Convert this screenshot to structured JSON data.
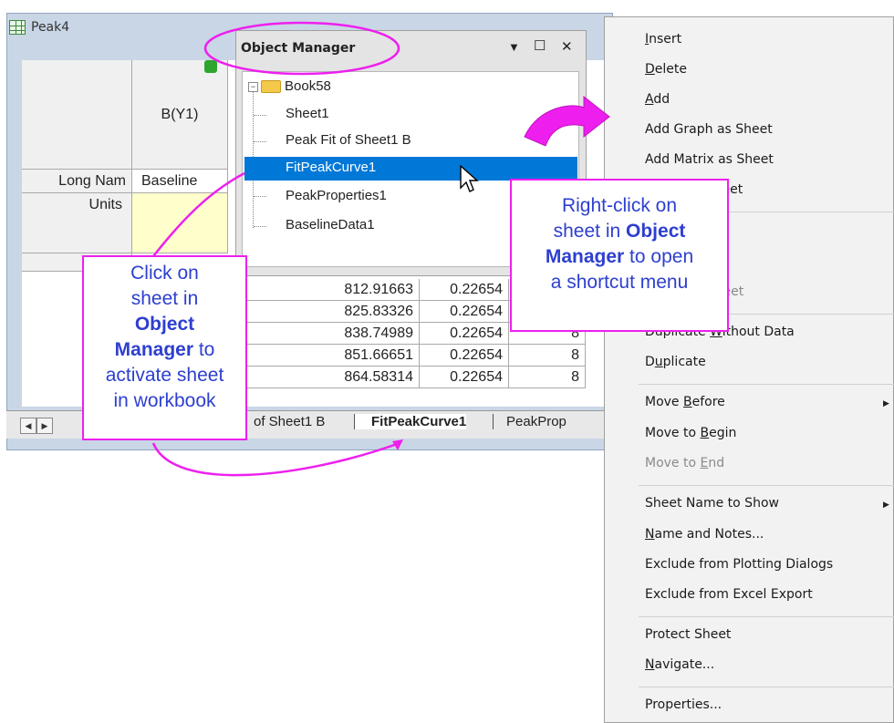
{
  "workbook": {
    "title": "Peak4",
    "col_b_header": "B(Y1)",
    "row_longname": "Long Nam",
    "row_units": "Units",
    "longname_b": "Baseline",
    "rows": [
      {
        "c": "812.91663",
        "d": "0.22654",
        "e": "8"
      },
      {
        "c": "825.83326",
        "d": "0.22654",
        "e": "8"
      },
      {
        "c": "838.74989",
        "d": "0.22654",
        "e": "8"
      },
      {
        "c": "851.66651",
        "d": "0.22654",
        "e": "8"
      },
      {
        "c": "864.58314",
        "d": "0.22654",
        "e": "8"
      }
    ],
    "tabs": {
      "tab1": "of Sheet1 B",
      "tab2": "FitPeakCurve1",
      "tab3": "PeakProp"
    },
    "nav_prev": "◀",
    "nav_next": "▶"
  },
  "object_manager": {
    "title": "Object Manager",
    "dropdown_label": "▼",
    "maximize_label": "☐",
    "close_label": "✕",
    "book": "Book58",
    "items": [
      "Sheet1",
      "Peak Fit of Sheet1 B",
      "FitPeakCurve1",
      "PeakProperties1",
      "BaselineData1"
    ],
    "selected_index": 2
  },
  "context_menu": {
    "insert": "Insert",
    "delete": "Delete",
    "add": "Add",
    "add_graph": "Add Graph as Sheet",
    "add_matrix": "Add Matrix as Sheet",
    "add_s_sheet_partial": "s Sheet",
    "v_sheet_partial": "v Sheet",
    "duplicate_without_data": "Duplicate Without Data",
    "duplicate": "Duplicate",
    "move_before": "Move Before",
    "move_to_begin": "Move to Begin",
    "move_to_end": "Move to End",
    "sheet_name_to_show": "Sheet Name to Show",
    "name_and_notes": "Name and Notes...",
    "exclude_plotting": "Exclude from Plotting Dialogs",
    "exclude_excel": "Exclude from Excel Export",
    "protect_sheet": "Protect Sheet",
    "navigate": "Navigate...",
    "properties": "Properties..."
  },
  "callouts": {
    "left": {
      "l1": "Click on",
      "l2": "sheet in",
      "l3": "Object",
      "l4": "Manager",
      "l4b": " to",
      "l5": "activate sheet",
      "l6": "in workbook"
    },
    "right": {
      "l1": "Right-click on",
      "l2a": "sheet in ",
      "l2b": "Object",
      "l3a": "Manager",
      "l3b": " to open",
      "l4": "a shortcut menu"
    }
  },
  "colors": {
    "accent_magenta": "#ee1fee",
    "callout_text": "#2d3fcf",
    "selection": "#0078d7"
  }
}
